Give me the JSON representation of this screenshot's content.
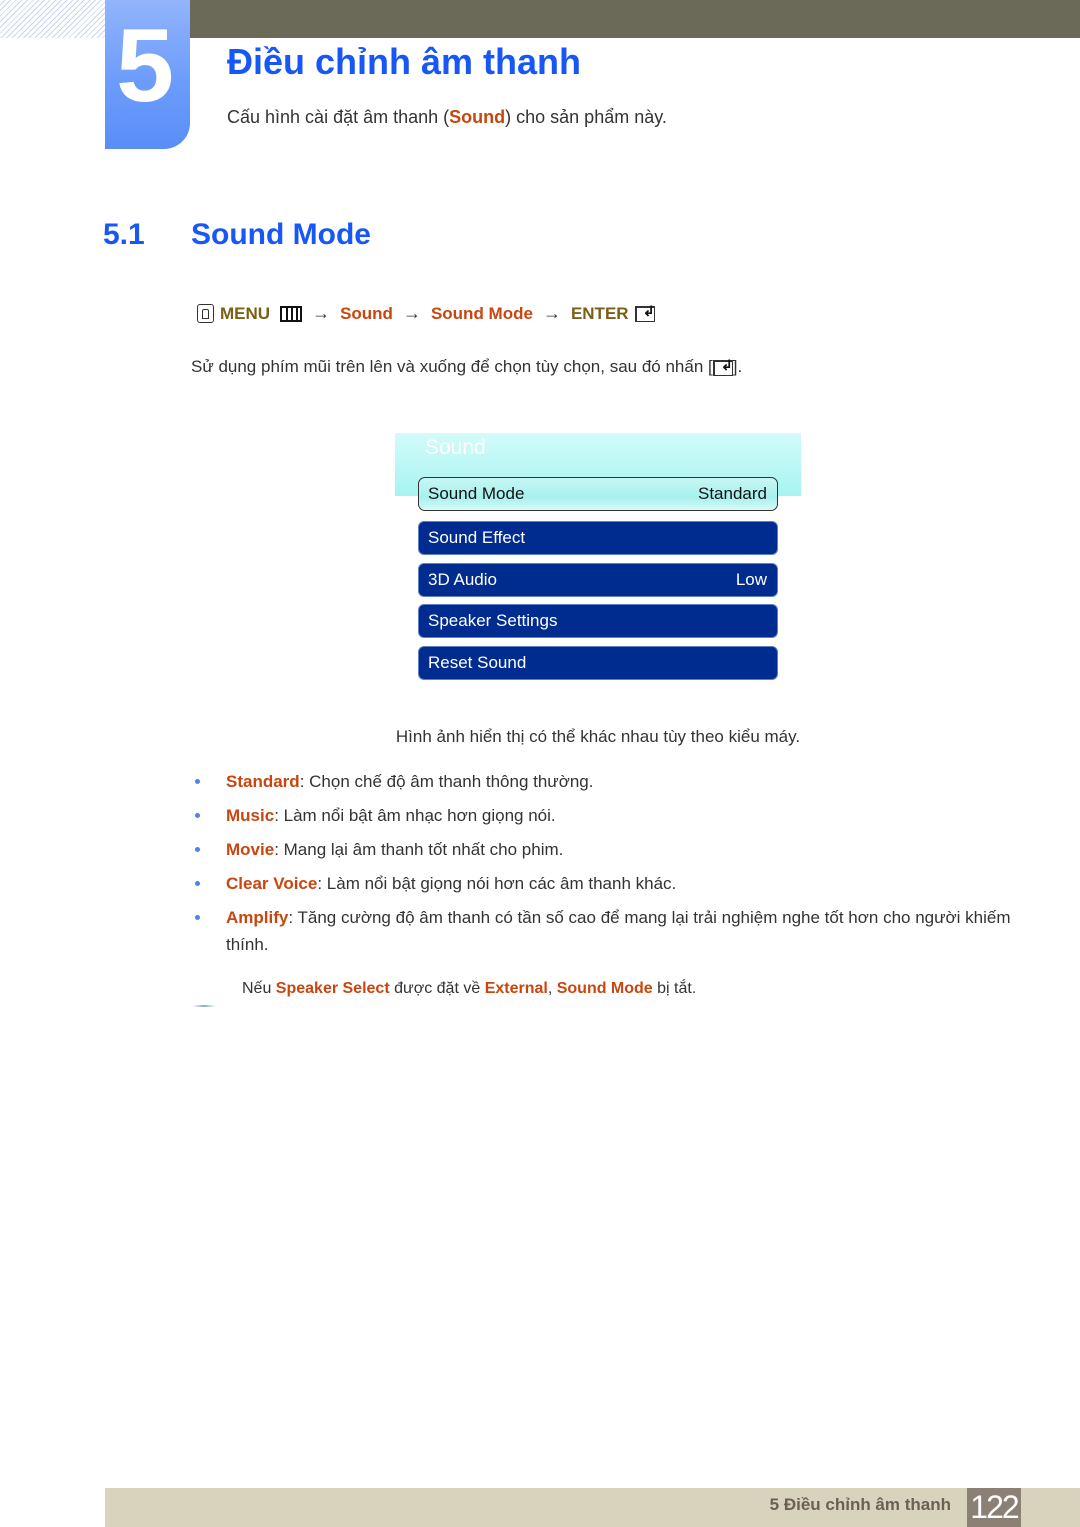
{
  "header": {
    "chapter_number": "5",
    "chapter_title": "Điều chỉnh âm thanh",
    "subtitle_before": "Cấu hình cài đặt âm thanh (",
    "subtitle_highlight": "Sound",
    "subtitle_after": ") cho sản phẩm này."
  },
  "section": {
    "number": "5.1",
    "title": "Sound Mode"
  },
  "menu_path": {
    "menu_label": "MENU",
    "arrow": "→",
    "steps": [
      "Sound",
      "Sound Mode"
    ],
    "enter_label": "ENTER"
  },
  "instruction": {
    "text": "Sử dụng phím mũi trên lên và xuống để chọn tùy chọn, sau đó nhấn [",
    "suffix": "]."
  },
  "osd": {
    "title": "Sound",
    "items": [
      {
        "label": "Sound Mode",
        "value": "Standard",
        "selected": true
      },
      {
        "label": "Sound Effect",
        "value": ""
      },
      {
        "label": "3D Audio",
        "value": "Low"
      },
      {
        "label": "Speaker Settings",
        "value": ""
      },
      {
        "label": "Reset Sound",
        "value": ""
      }
    ]
  },
  "caption": "Hình ảnh hiển thị có thể khác nhau tùy theo kiểu máy.",
  "options": [
    {
      "term": "Standard",
      "desc": ": Chọn chế độ âm thanh thông thường."
    },
    {
      "term": "Music",
      "desc": ": Làm nổi bật âm nhạc hơn giọng nói."
    },
    {
      "term": "Movie",
      "desc": ": Mang lại âm thanh tốt nhất cho phim."
    },
    {
      "term": "Clear Voice",
      "desc": ": Làm nổi bật giọng nói hơn các âm thanh khác."
    },
    {
      "term": "Amplify",
      "desc": ": Tăng cường độ âm thanh có tần số cao để mang lại trải nghiệm nghe tốt hơn cho người khiếm thính."
    }
  ],
  "note": {
    "prefix": "Nếu ",
    "term1": "Speaker Select",
    "mid1": " được đặt về ",
    "term2": "External",
    "mid2": ", ",
    "term3": "Sound Mode",
    "suffix": " bị tắt."
  },
  "footer": {
    "label": "5 Điều chỉnh âm thanh",
    "page_number": "122"
  },
  "colors": {
    "heading_blue": "#1757f5",
    "highlight_orange": "#c8460f",
    "menu_brown": "#7a5f14",
    "osd_item_blue": "#002b8f",
    "footer_bg": "#d8d3bd",
    "page_num_bg": "#8c7f74"
  }
}
